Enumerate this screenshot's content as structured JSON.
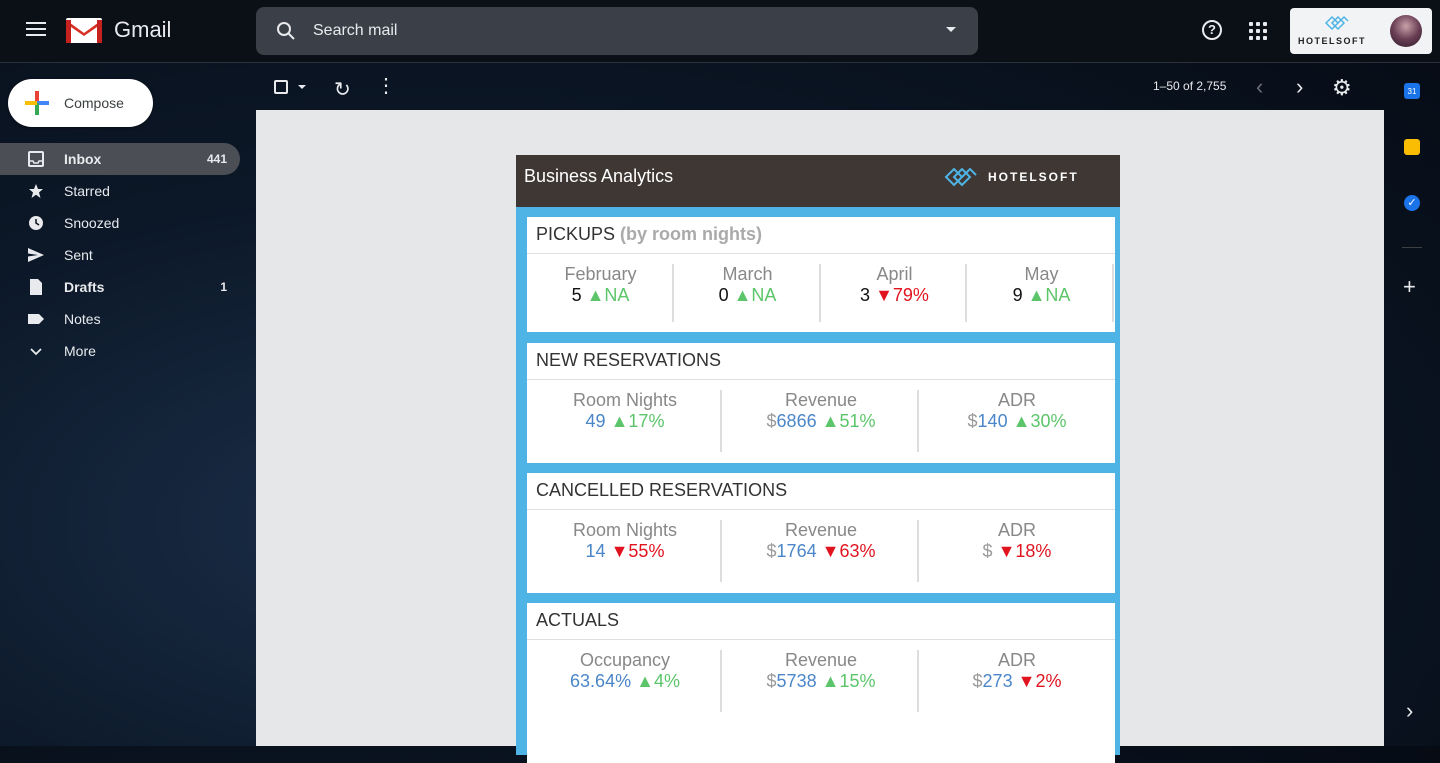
{
  "app": {
    "title": "Gmail"
  },
  "search": {
    "placeholder": "Search mail"
  },
  "account": {
    "brand": "HOTELSOFT"
  },
  "toolbar": {
    "count": "1–50 of 2,755"
  },
  "compose": {
    "label": "Compose"
  },
  "sidebar": {
    "items": [
      {
        "label": "Inbox",
        "count": "441",
        "icon": "inbox-icon"
      },
      {
        "label": "Starred",
        "count": "",
        "icon": "star-icon"
      },
      {
        "label": "Snoozed",
        "count": "",
        "icon": "clock-icon"
      },
      {
        "label": "Sent",
        "count": "",
        "icon": "send-icon"
      },
      {
        "label": "Drafts",
        "count": "1",
        "icon": "draft-icon"
      },
      {
        "label": "Notes",
        "count": "",
        "icon": "label-icon"
      },
      {
        "label": "More",
        "count": "",
        "icon": "chevron-down-icon"
      }
    ]
  },
  "rightbar": {
    "calendar_day": "31"
  },
  "email": {
    "header_title": "Business Analytics",
    "brand": "HOTELSOFT",
    "pickups": {
      "title": "PICKUPS",
      "subtitle": "(by room nights)",
      "months": [
        {
          "label": "February",
          "value": "5",
          "arrow": "▲",
          "change": "NA",
          "dir": "up"
        },
        {
          "label": "March",
          "value": "0",
          "arrow": "▲",
          "change": "NA",
          "dir": "up"
        },
        {
          "label": "April",
          "value": "3",
          "arrow": "▼",
          "change": "79%",
          "dir": "down"
        },
        {
          "label": "May",
          "value": "9",
          "arrow": "▲",
          "change": "NA",
          "dir": "up"
        }
      ]
    },
    "new_reservations": {
      "title": "NEW RESERVATIONS",
      "metrics": [
        {
          "label": "Room Nights",
          "prefix": "",
          "value": "49",
          "arrow": "▲",
          "change": "17%",
          "dir": "up"
        },
        {
          "label": "Revenue",
          "prefix": "$",
          "value": "6866",
          "arrow": "▲",
          "change": "51%",
          "dir": "up"
        },
        {
          "label": "ADR",
          "prefix": "$",
          "value": "140",
          "arrow": "▲",
          "change": "30%",
          "dir": "up"
        }
      ]
    },
    "cancelled_reservations": {
      "title": "CANCELLED RESERVATIONS",
      "metrics": [
        {
          "label": "Room Nights",
          "prefix": "",
          "value": "14",
          "arrow": "▼",
          "change": "55%",
          "dir": "down"
        },
        {
          "label": "Revenue",
          "prefix": "$",
          "value": "1764",
          "arrow": "▼",
          "change": "63%",
          "dir": "down"
        },
        {
          "label": "ADR",
          "prefix": "$",
          "value": "",
          "arrow": "▼",
          "change": "18%",
          "dir": "down"
        }
      ]
    },
    "actuals": {
      "title": "ACTUALS",
      "metrics": [
        {
          "label": "Occupancy",
          "prefix": "",
          "value": "63.64%",
          "arrow": "▲",
          "change": "4%",
          "dir": "up"
        },
        {
          "label": "Revenue",
          "prefix": "$",
          "value": "5738",
          "arrow": "▲",
          "change": "15%",
          "dir": "up"
        },
        {
          "label": "ADR",
          "prefix": "$",
          "value": "273",
          "arrow": "▼",
          "change": "2%",
          "dir": "down"
        }
      ]
    }
  }
}
